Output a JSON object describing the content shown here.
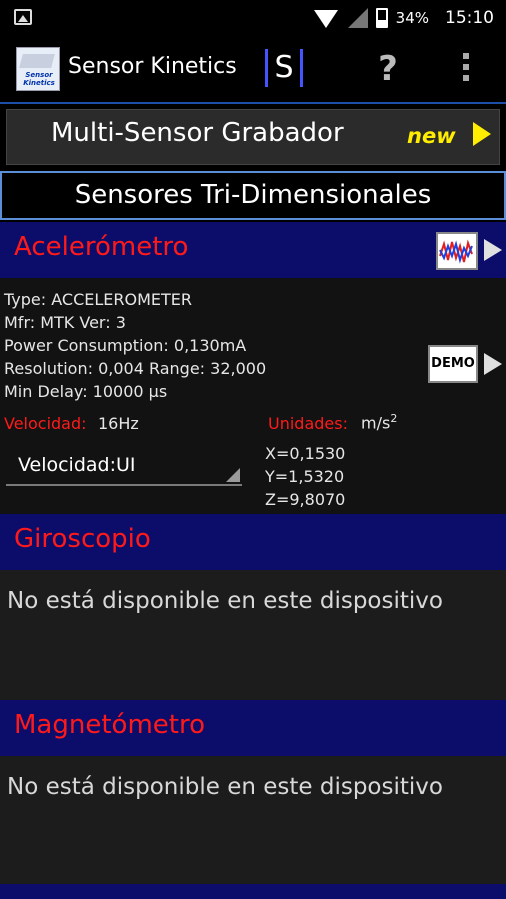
{
  "status_bar": {
    "battery": "34%",
    "time": "15:10"
  },
  "app_bar": {
    "title": "Sensor Kinetics",
    "logo_text": "Sensor Kinetics",
    "s_icon": "S",
    "help_icon": "?"
  },
  "multi_sensor": {
    "label": "Multi-Sensor Grabador",
    "badge": "new"
  },
  "section": {
    "title": "Sensores Tri-Dimensionales"
  },
  "accelerometer": {
    "name": "Acelerómetro",
    "type": "Type: ACCELEROMETER",
    "mfr": "Mfr: MTK  Ver: 3",
    "power": "Power Consumption: 0,130mA",
    "resolution": "Resolution: 0,004 Range: 32,000",
    "min_delay": "Min Delay: 10000 µs",
    "demo_label": "DEMO",
    "velocity_label": "Velocidad:",
    "velocity_value": "16Hz",
    "units_label": "Unidades:",
    "units_value": "m/s",
    "units_exp": "2",
    "spinner_value": "Velocidad:UI",
    "x": "X=0,1530",
    "y": "Y=1,5320",
    "z": "Z=9,8070"
  },
  "gyroscope": {
    "name": "Giroscopio",
    "message": "No está disponible en este dispositivo"
  },
  "magnetometer": {
    "name": "Magnetómetro",
    "message": "No está disponible en este dispositivo"
  },
  "colors": {
    "header_bg": "#0c0c6a",
    "sensor_name": "#ff1a1a",
    "accent_line": "#1e4fa8",
    "new_badge": "#ffee00"
  }
}
